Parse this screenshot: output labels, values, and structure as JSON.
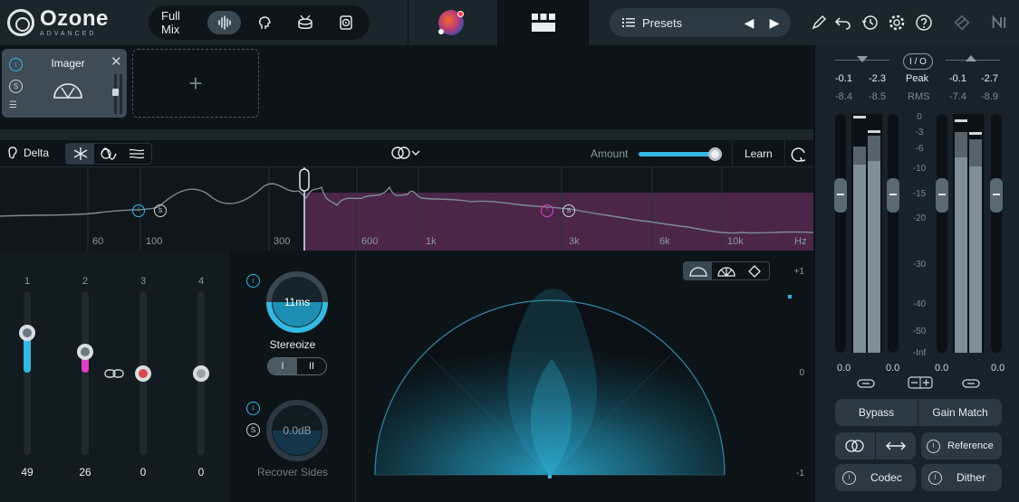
{
  "app": {
    "title": "Ozone",
    "subtitle": "ADVANCED"
  },
  "header": {
    "mix_label": "Full Mix",
    "presets_label": "Presets"
  },
  "module": {
    "title": "Imager"
  },
  "toolbar": {
    "delta_label": "Delta",
    "amount_label": "Amount",
    "amount_value": 1.0,
    "learn_label": "Learn"
  },
  "spectrum": {
    "freq_labels": [
      "60",
      "100",
      "300",
      "600",
      "1k",
      "3k",
      "6k",
      "10k",
      "Hz"
    ]
  },
  "bands": [
    {
      "number": "1",
      "value": "49",
      "level": 0.49,
      "color": "#34b9e3"
    },
    {
      "number": "2",
      "value": "26",
      "level": 0.26,
      "color": "#e040c8"
    },
    {
      "number": "3",
      "value": "0",
      "level": 0.0,
      "color": "#d9474d"
    },
    {
      "number": "4",
      "value": "0",
      "level": 0.0,
      "color": "#9aa5ab"
    }
  ],
  "stereoize": {
    "knob_value": "11ms",
    "label": "Stereoize",
    "mode_1": "I",
    "mode_2": "II"
  },
  "recover_sides": {
    "knob_value": "0.0dB",
    "label": "Recover Sides"
  },
  "vectorscope": {
    "scale_top": "+1",
    "scale_mid": "0",
    "scale_bottom": "-1"
  },
  "meters": {
    "io_label": "I / O",
    "input_peak_l": "-0.1",
    "input_peak_r": "-2.3",
    "input_rms_l": "-8.4",
    "input_rms_r": "-8.5",
    "output_peak_l": "-0.1",
    "output_peak_r": "-2.7",
    "output_rms_l": "-7.4",
    "output_rms_r": "-8.9",
    "peak_label": "Peak",
    "rms_label": "RMS",
    "scale": [
      "0",
      "-3",
      "-6",
      "-10",
      "-15",
      "-20",
      "-30",
      "-40",
      "-50",
      "-Inf"
    ],
    "gain_in_l": "0.0",
    "gain_in_r": "0.0",
    "gain_out_l": "0.0",
    "gain_out_r": "0.0",
    "bypass_label": "Bypass",
    "gain_match_label": "Gain Match",
    "reference_label": "Reference",
    "codec_label": "Codec",
    "dither_label": "Dither"
  },
  "colors": {
    "accent": "#34b9e3",
    "band2": "#e040c8",
    "spectrum_highlight": "#5a2a55"
  }
}
